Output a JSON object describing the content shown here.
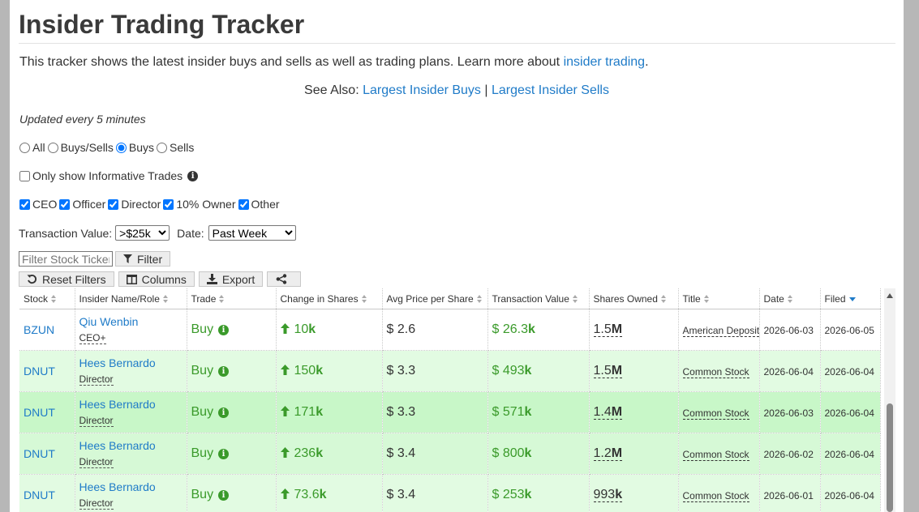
{
  "header": {
    "title": "Insider Trading Tracker",
    "intro": "This tracker shows the latest insider buys and sells as well as trading plans. Learn more about ",
    "intro_link": "insider trading",
    "intro_end": ".",
    "see_also_label": "See Also: ",
    "see_also_links": [
      "Largest Insider Buys",
      "Largest Insider Sells"
    ],
    "see_also_sep": " | "
  },
  "updated_text": "Updated every 5 minutes",
  "trade_type": {
    "options": [
      "All",
      "Buys/Sells",
      "Buys",
      "Sells"
    ],
    "selected": "Buys"
  },
  "informative": {
    "label": "Only show Informative Trades",
    "checked": false
  },
  "roles": {
    "options": [
      "CEO",
      "Officer",
      "Director",
      "10% Owner",
      "Other"
    ],
    "checked": [
      true,
      true,
      true,
      true,
      true
    ]
  },
  "transaction_value": {
    "label": "Transaction Value:",
    "selected": ">$25k"
  },
  "date_filter": {
    "label": "Date:",
    "selected": "Past Week"
  },
  "filter": {
    "placeholder": "Filter Stock Ticker",
    "button": "Filter"
  },
  "toolbar": {
    "reset": "Reset Filters",
    "columns": "Columns",
    "export": "Export"
  },
  "table": {
    "columns": [
      "Stock",
      "Insider Name/Role",
      "Trade",
      "Change in Shares",
      "Avg Price per Share",
      "Transaction Value",
      "Shares Owned",
      "Title",
      "Date",
      "Filed"
    ],
    "sorted_column": "Filed",
    "rows": [
      {
        "stock": "BZUN",
        "name": "Qiu Wenbin",
        "role": "CEO+",
        "trade": "Buy",
        "change_num": "10",
        "change_unit": "k",
        "price": "$ 2.6",
        "value_num": "$ 26.3",
        "value_unit": "k",
        "owned_num": "1.5",
        "owned_unit": "M",
        "title": "American Deposit",
        "date": "2026-06-03",
        "filed": "2026-06-05"
      },
      {
        "stock": "DNUT",
        "name": "Hees Bernardo",
        "role": "Director",
        "trade": "Buy",
        "change_num": "150",
        "change_unit": "k",
        "price": "$ 3.3",
        "value_num": "$ 493",
        "value_unit": "k",
        "owned_num": "1.5",
        "owned_unit": "M",
        "title": "Common Stock",
        "date": "2026-06-04",
        "filed": "2026-06-04"
      },
      {
        "stock": "DNUT",
        "name": "Hees Bernardo",
        "role": "Director",
        "trade": "Buy",
        "change_num": "171",
        "change_unit": "k",
        "price": "$ 3.3",
        "value_num": "$ 571",
        "value_unit": "k",
        "owned_num": "1.4",
        "owned_unit": "M",
        "title": "Common Stock",
        "date": "2026-06-03",
        "filed": "2026-06-04"
      },
      {
        "stock": "DNUT",
        "name": "Hees Bernardo",
        "role": "Director",
        "trade": "Buy",
        "change_num": "236",
        "change_unit": "k",
        "price": "$ 3.4",
        "value_num": "$ 800",
        "value_unit": "k",
        "owned_num": "1.2",
        "owned_unit": "M",
        "title": "Common Stock",
        "date": "2026-06-02",
        "filed": "2026-06-04"
      },
      {
        "stock": "DNUT",
        "name": "Hees Bernardo",
        "role": "Director",
        "trade": "Buy",
        "change_num": "73.6",
        "change_unit": "k",
        "price": "$ 3.4",
        "value_num": "$ 253",
        "value_unit": "k",
        "owned_num": "993",
        "owned_unit": "k",
        "title": "Common Stock",
        "date": "2026-06-01",
        "filed": "2026-06-04"
      }
    ]
  },
  "colors": {
    "link": "#1f7bc8",
    "buy_green": "#3a9a2a",
    "row_backgrounds": [
      "#ffffff",
      "#e2fbe2",
      "#c8f7c8",
      "#d6f9d6",
      "#e2fbe2"
    ]
  }
}
